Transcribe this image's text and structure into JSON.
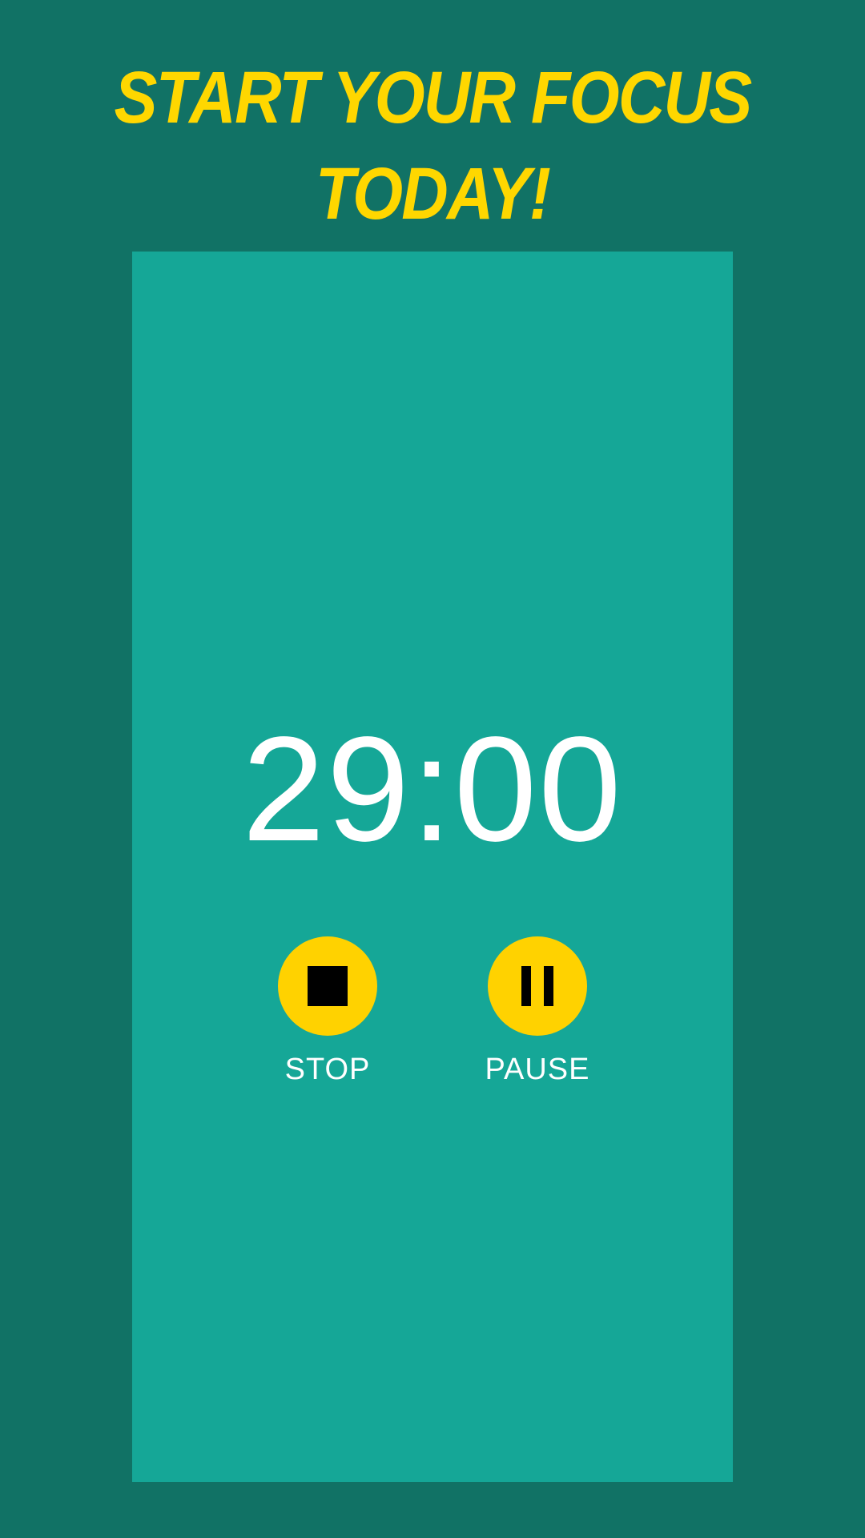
{
  "header": {
    "line1": "START YOUR FOCUS",
    "line2": "TODAY!"
  },
  "timer": {
    "display": "29:00"
  },
  "controls": {
    "stop": {
      "label": "STOP",
      "icon": "stop-icon"
    },
    "pause": {
      "label": "PAUSE",
      "icon": "pause-icon"
    }
  },
  "colors": {
    "background": "#117265",
    "panel": "#15A797",
    "accent": "#FFD700",
    "text": "#FFFFFF"
  }
}
